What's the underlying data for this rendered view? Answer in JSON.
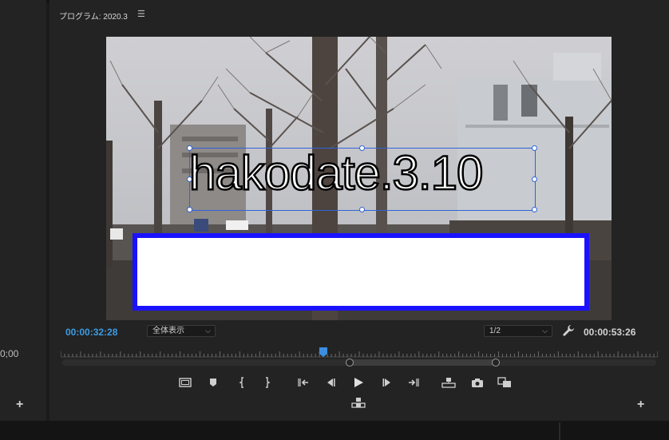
{
  "left_panel": {
    "timecode": "0;00",
    "add_label": "+"
  },
  "panel": {
    "title": "プログラム: 2020.3",
    "menu_icon": "hamburger-icon",
    "add_label": "+"
  },
  "video": {
    "title_text": "hakodate.3.10",
    "box_fill": "#ffffff",
    "box_border": "#1a12ff",
    "selection_color": "#2f63d8"
  },
  "status": {
    "current_timecode": "00:00:32:28",
    "duration_timecode": "00:00:53:26",
    "zoom": "全体表示",
    "resolution": "1/2",
    "playhead_fraction": 0.44,
    "accent": "#3b9ce3"
  },
  "controls": [
    "marker-toggle-icon",
    "add-marker-icon",
    "mark-in-icon",
    "mark-out-icon",
    "go-to-in-icon",
    "step-back-icon",
    "play-icon",
    "step-forward-icon",
    "go-to-out-icon",
    "lift-icon",
    "export-frame-icon",
    "compare-icon",
    "extract-icon"
  ]
}
